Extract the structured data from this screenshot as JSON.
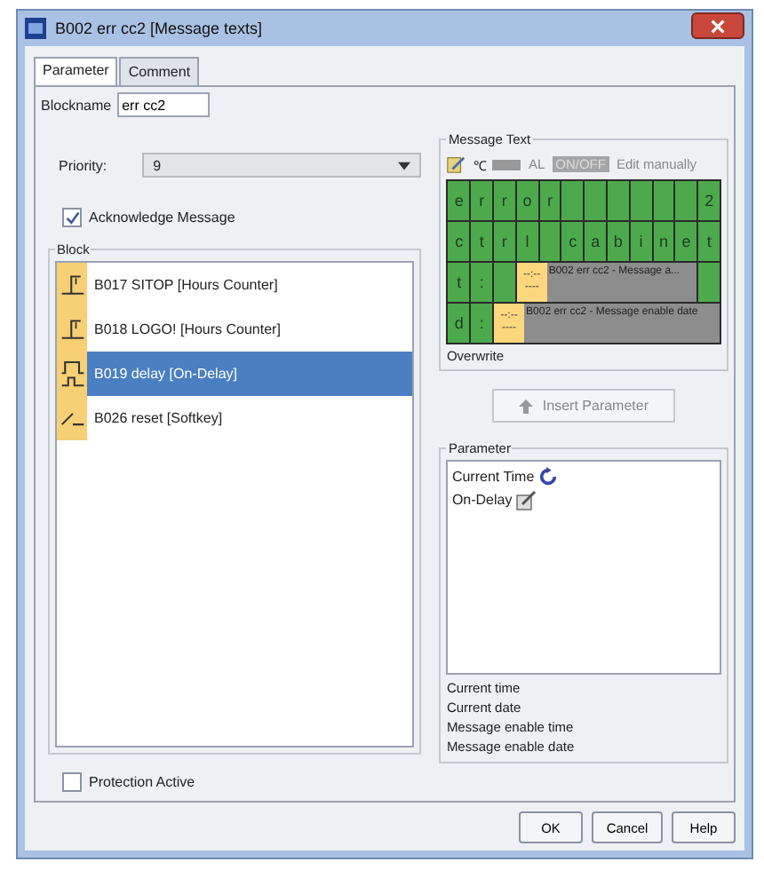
{
  "window": {
    "title": "B002 err cc2 [Message texts]"
  },
  "tabs": [
    {
      "label": "Parameter",
      "selected": true
    },
    {
      "label": "Comment",
      "selected": false
    }
  ],
  "blockname": {
    "label": "Blockname",
    "value": "err cc2"
  },
  "priority": {
    "label": "Priority:",
    "value": "9"
  },
  "acknowledge": {
    "label": "Acknowledge Message",
    "checked": true
  },
  "block_group": {
    "title": "Block",
    "items": [
      {
        "label": "B017 SITOP [Hours Counter]",
        "kind": "counter",
        "selected": false
      },
      {
        "label": "B018 LOGO! [Hours Counter]",
        "kind": "counter",
        "selected": false
      },
      {
        "label": "B019 delay [On-Delay]",
        "kind": "delay",
        "selected": true
      },
      {
        "label": "B026 reset [Softkey]",
        "kind": "softkey",
        "selected": false
      }
    ]
  },
  "message_text": {
    "title": "Message Text",
    "toolbar": {
      "degree": "℃",
      "alarm": "AL",
      "on_off": "ON/OFF",
      "edit": "Edit manually"
    },
    "rows": [
      [
        {
          "kind": "char",
          "text": "e"
        },
        {
          "kind": "char",
          "text": "r"
        },
        {
          "kind": "char",
          "text": "r"
        },
        {
          "kind": "char",
          "text": "o"
        },
        {
          "kind": "char",
          "text": "r"
        },
        {
          "kind": "blank"
        },
        {
          "kind": "blank"
        },
        {
          "kind": "blank"
        },
        {
          "kind": "blank"
        },
        {
          "kind": "blank"
        },
        {
          "kind": "blank"
        },
        {
          "kind": "char",
          "text": "2"
        }
      ],
      [
        {
          "kind": "char",
          "text": "c"
        },
        {
          "kind": "char",
          "text": "t"
        },
        {
          "kind": "char",
          "text": "r"
        },
        {
          "kind": "char",
          "text": "l"
        },
        {
          "kind": "blank"
        },
        {
          "kind": "char",
          "text": "c"
        },
        {
          "kind": "char",
          "text": "a"
        },
        {
          "kind": "char",
          "text": "b"
        },
        {
          "kind": "char",
          "text": "i"
        },
        {
          "kind": "char",
          "text": "n"
        },
        {
          "kind": "char",
          "text": "e"
        },
        {
          "kind": "char",
          "text": "t"
        }
      ],
      [
        {
          "kind": "char",
          "text": "t"
        },
        {
          "kind": "char",
          "text": ":"
        },
        {
          "kind": "blank"
        },
        {
          "kind": "param",
          "mask": [
            "--:--",
            "----"
          ],
          "text": "B002 err cc2 - Message a..."
        },
        {
          "kind": "blank"
        }
      ],
      [
        {
          "kind": "char",
          "text": "d"
        },
        {
          "kind": "char",
          "text": ":"
        },
        {
          "kind": "param",
          "mask": [
            "--:--",
            "----"
          ],
          "text": "B002 err cc2 - Message enable date"
        }
      ]
    ],
    "mode": "Overwrite"
  },
  "insert_button": "Insert Parameter",
  "parameter_group": {
    "title": "Parameter",
    "items": [
      {
        "label": "Current Time",
        "kind": "time"
      },
      {
        "label": "On-Delay",
        "kind": "block"
      }
    ],
    "options": [
      "Current time",
      "Current date",
      "Message enable time",
      "Message enable date"
    ]
  },
  "protection": {
    "label": "Protection Active",
    "checked": false
  },
  "buttons": [
    "OK",
    "Cancel",
    "Help"
  ]
}
